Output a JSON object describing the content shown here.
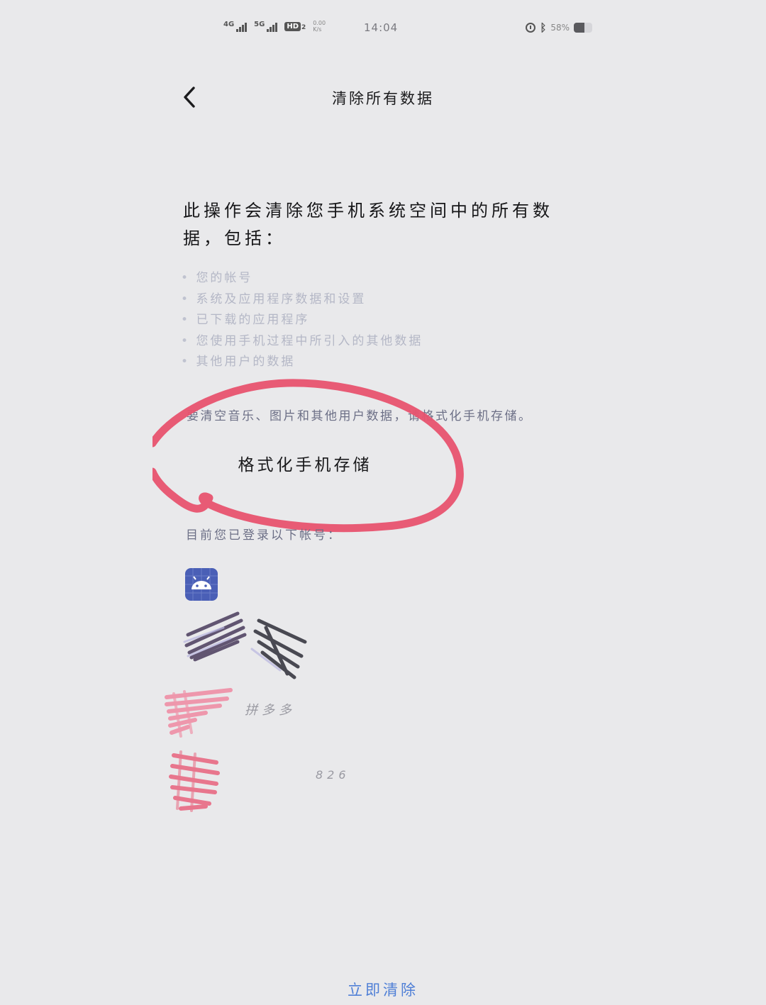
{
  "status_bar": {
    "network_1": "4G",
    "network_2": "5G",
    "hd_label": "HD",
    "hd_sub": "2",
    "speed_top": "0.00",
    "speed_bottom": "K/s",
    "time": "14:04",
    "battery_percent": "58%",
    "battery_level": 0.58,
    "icons": [
      "alarm-icon",
      "bluetooth-icon",
      "battery-icon"
    ]
  },
  "header": {
    "back_icon": "chevron-left-icon",
    "title": "清除所有数据"
  },
  "intro": {
    "text": "此操作会清除您手机系统空间中的所有数据，包括："
  },
  "bullets": [
    "您的帐号",
    "系统及应用程序数据和设置",
    "已下载的应用程序",
    "您使用手机过程中所引入的其他数据",
    "其他用户的数据"
  ],
  "format_note": "要清空音乐、图片和其他用户数据，请格式化手机存储。",
  "format_button": {
    "label": "格式化手机存储"
  },
  "accounts_label": "目前您已登录以下帐号：",
  "accounts": {
    "app_icon": "android-icon",
    "visible_texts": [
      "拼多多",
      "826"
    ]
  },
  "annotation": {
    "shape": "hand-drawn circle",
    "color": "#e8536f"
  },
  "clear_now_button": {
    "label": "立即清除",
    "color": "#4f7fd6"
  }
}
